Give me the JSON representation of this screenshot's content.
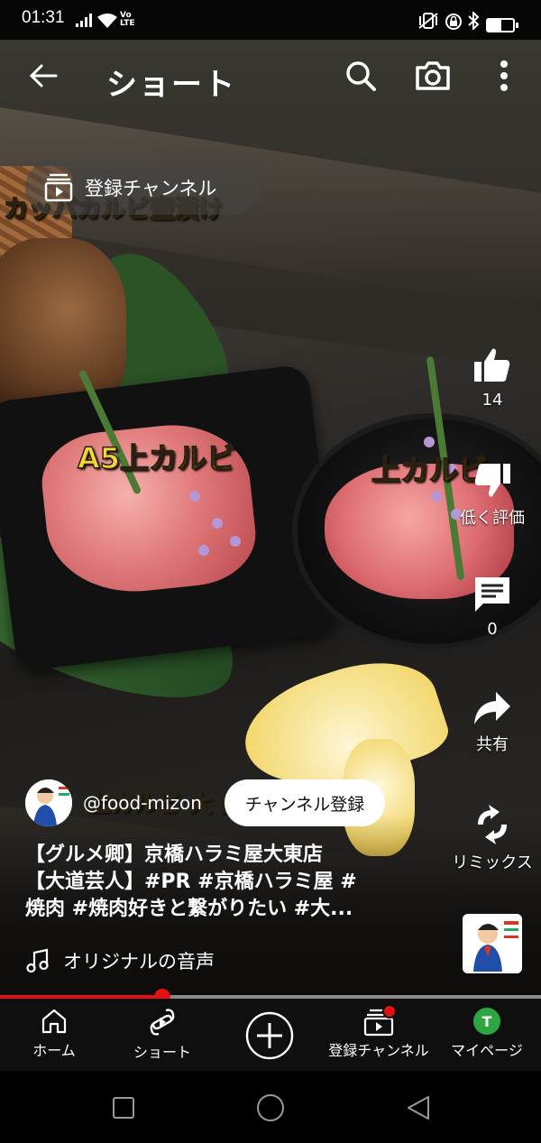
{
  "status_bar": {
    "time": "01:31",
    "network": "Vo LTE",
    "battery_level": 0.55
  },
  "top_bar": {
    "title": "ショート",
    "icons": [
      "back-arrow-icon",
      "search-icon",
      "camera-icon",
      "more-vert-icon"
    ]
  },
  "subscription_pill": {
    "label": "登録チャンネル"
  },
  "video_overlay": {
    "title_top": "カッパカルビ壷漬け",
    "label_a5": "A5上カルビ",
    "label_kalbi": "上カルビ",
    "label_bottom": "上カルビ 大 壷漬け"
  },
  "actions": {
    "like_count": "14",
    "dislike_label": "低く評価",
    "comment_count": "0",
    "share_label": "共有",
    "remix_label": "リミックス"
  },
  "channel": {
    "handle": "@food-mizon",
    "subscribe_label": "チャンネル登録"
  },
  "description": {
    "line1": "【グルメ卿】京橋ハラミ屋大東店",
    "line2": "【大道芸人】#PR #京橋ハラミ屋 #",
    "line3": "焼肉 #焼肉好きと繋がりたい #大..."
  },
  "sound": {
    "label": "オリジナルの音声"
  },
  "progress": {
    "fraction": 0.3
  },
  "bottom_nav": {
    "home": "ホーム",
    "shorts": "ショート",
    "subscriptions": "登録チャンネル",
    "my_page": "マイページ",
    "avatar_initial": "T"
  },
  "colors": {
    "accent_red": "#e31212",
    "overlay_text": "#f4d637",
    "avatar_green": "#2ba640"
  }
}
